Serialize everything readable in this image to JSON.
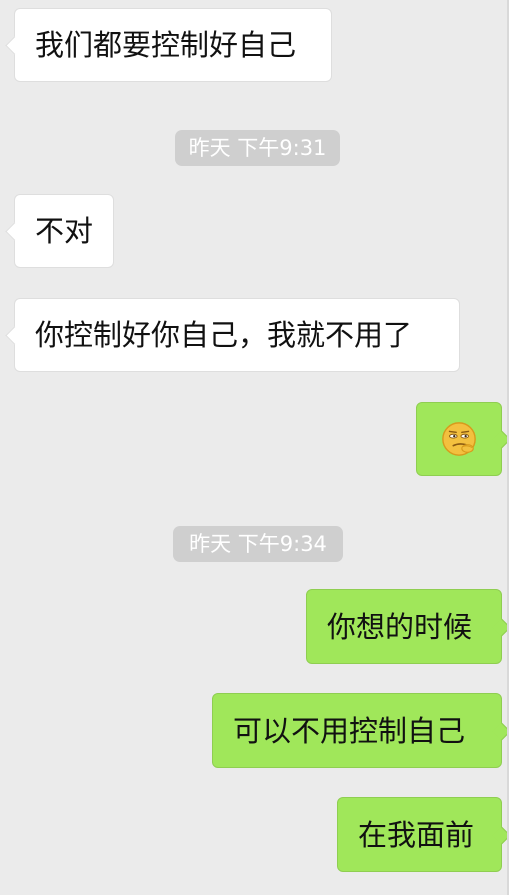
{
  "messages": [
    {
      "side": "incoming",
      "text": "我们都要控制好自己"
    },
    {
      "side": "incoming",
      "text": "不对"
    },
    {
      "side": "incoming",
      "text": "你控制好你自己，我就不用了"
    },
    {
      "side": "outgoing",
      "emoji": "smirk-face-emoji"
    },
    {
      "side": "outgoing",
      "text": "你想的时候"
    },
    {
      "side": "outgoing",
      "text": "可以不用控制自己"
    },
    {
      "side": "outgoing",
      "text": "在我面前"
    }
  ],
  "timestamps": [
    {
      "text": "昨天 下午9:31"
    },
    {
      "text": "昨天 下午9:34"
    }
  ],
  "colors": {
    "background": "#ebebeb",
    "incoming_bubble": "#ffffff",
    "outgoing_bubble": "#a0e75a",
    "timestamp_pill": "#cfcfcf",
    "timestamp_text": "#ffffff",
    "message_text": "#111111"
  }
}
